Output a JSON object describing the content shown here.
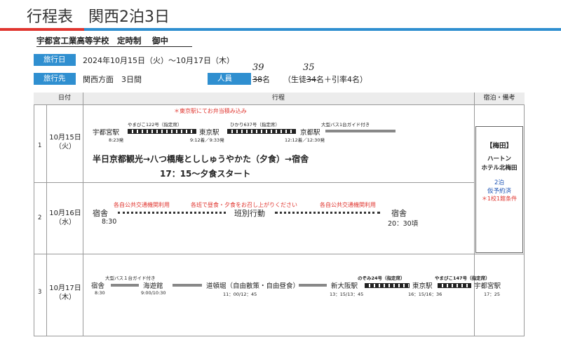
{
  "header": {
    "title": "行程表　関西2泊3日"
  },
  "colors": {
    "accent": "#2f8fd0",
    "rule_red": "#e0352f",
    "bar": "#222222",
    "note_red": "#e0352f",
    "note_blue": "#1f55b5"
  },
  "school": "宇都宮工業高等学校　定時制　 御中",
  "info": {
    "dates_label": "旅行日",
    "dates_value": "2024年10月15日（火）～10月17日（木）",
    "dest_label": "旅行先",
    "dest_value": "関西方面　3日間",
    "people_label": "人員",
    "people_hand_total": "39",
    "people_old_total": "38",
    "people_unit": "名",
    "people_hand_students": "35",
    "people_students_prefix": "（生徒",
    "people_old_students": "34",
    "people_students_suffix": "名＋引率4名）"
  },
  "table": {
    "headers": {
      "date": "日付",
      "itinerary": "行程",
      "stay": "宿泊・備考"
    },
    "rows": [
      {
        "no": "1",
        "date": "10月15日",
        "dow": "（火）",
        "note": "＊東京駅にてお弁当積み込み",
        "stations": [
          "宇都宮駅",
          "東京駅",
          "京都駅"
        ],
        "trains": [
          "やまびこ122号（指定席）",
          "ひかり637号（指定席）",
          "大型バス1台ガイド付き"
        ],
        "times": [
          "8:23発",
          "9:12着／9:33発",
          "12:12着／12:30発"
        ],
        "main": "半日京都観光→八つ橋庵とししゅうやかた（夕食）→宿舎",
        "sub": "17：15～夕食スタート"
      },
      {
        "no": "2",
        "date": "10月16日",
        "dow": "（水）",
        "red_notes": [
          "各自公共交通機関利用",
          "各班で昼食・夕食をお召し上がりください",
          "各自公共交通機関利用"
        ],
        "start": "宿舎",
        "start_time": "8:30",
        "middle": "班別行動",
        "end": "宿舎",
        "end_time": "20：30頃"
      },
      {
        "no": "3",
        "date": "10月17日",
        "dow": "（木）",
        "stations": [
          "宿舎",
          "海遊館",
          "道頓堀（自由散策・自由昼食）",
          "新大阪駅",
          "東京駅",
          "宇都宮駅"
        ],
        "transports": [
          "大型バス１台ガイド付き",
          "のぞみ24号（指定席）",
          "やまびこ147号（指定席）"
        ],
        "times": [
          "8:30",
          "9:00/10:30",
          "11：00/12：45",
          "13：15/13：45",
          "16：15/16：36",
          "17：25"
        ]
      }
    ],
    "stay": {
      "name": "【梅田】",
      "hotel1": "ハートン",
      "hotel2": "ホテル北梅田",
      "nights": "2泊",
      "status": "仮予約済",
      "condition": "＊1校1館条件"
    }
  }
}
